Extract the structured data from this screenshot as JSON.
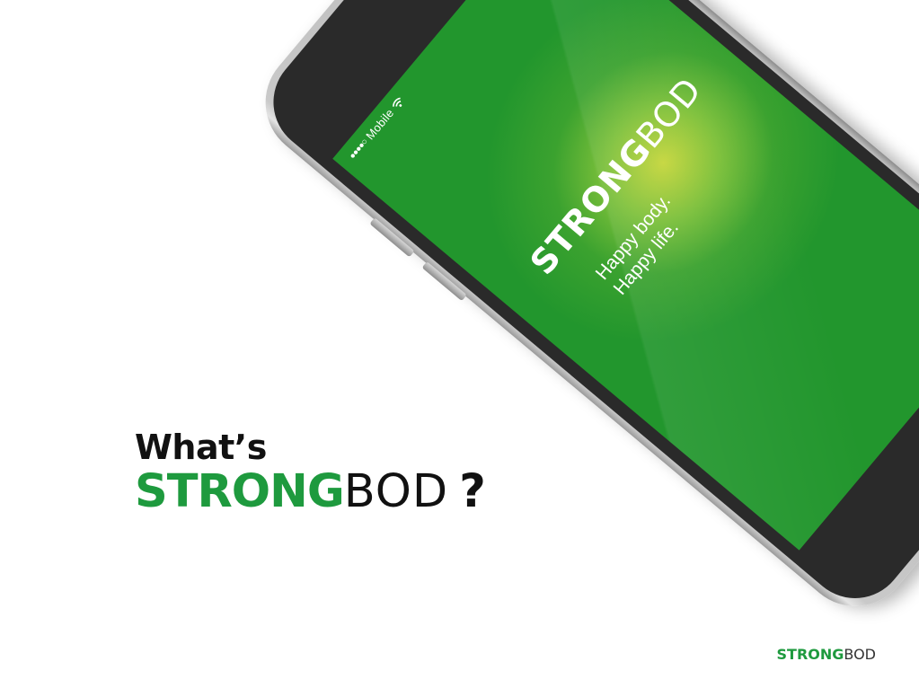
{
  "phone": {
    "status_bar": {
      "signal": "●●●●○",
      "carrier": "Mobile",
      "wifi_icon": "wifi-icon"
    },
    "screen": {
      "logo_strong": "STRONG",
      "logo_bod": "BOD",
      "tagline_line1": "Happy body.",
      "tagline_line2": "Happy life."
    }
  },
  "headline": {
    "line1": "What’s",
    "brand_strong": "STRONG",
    "brand_bod": "BOD",
    "question_mark": "?"
  },
  "footer_logo": {
    "strong": "STRONG",
    "bod": "BOD"
  },
  "colors": {
    "brand_green": "#1e9a3e",
    "screen_green": "#22962d",
    "screen_highlight": "#c5d63c",
    "text_dark": "#111111",
    "background": "#ffffff"
  }
}
